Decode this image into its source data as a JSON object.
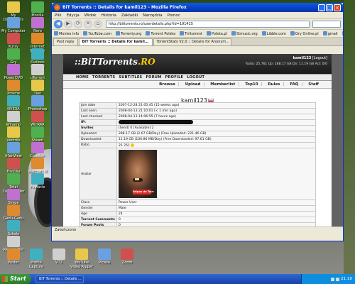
{
  "desktop": {
    "icons_left": [
      "My Documents",
      "My Computer",
      "Kursy",
      "Gry",
      "PowerDVD",
      "Xtreme",
      "NVIDIA Control",
      "Winamp",
      "Ventrilo",
      "IrfanView",
      "FileZilla",
      "Total Commander",
      "Skype",
      "Gadu-Gadu",
      "Szkoła",
      "Recycle Bin"
    ],
    "icons_col2": [
      "Mozilla Firefox",
      "Nero",
      "Internet Explorer",
      "Outlook Express",
      "uTorrent",
      "Tlen",
      "Photoshop",
      "WinRAR",
      "Steam",
      "Counter-Strike",
      "Warcraft III",
      "Pinnacle"
    ],
    "icons_bottom": [
      "Poster",
      "Profile Capture",
      "VT3",
      "YouTube Video Ripper",
      "Picasa",
      "Zoom"
    ]
  },
  "window": {
    "title": "BiT Torrents :: Details for kamil123 - Mozilla Firefox",
    "minimize": "_",
    "maximize": "□",
    "close": "×"
  },
  "menubar": [
    "Plik",
    "Edycja",
    "Widok",
    "Historia",
    "Zakładki",
    "Narzędzia",
    "Pomoc"
  ],
  "navbar": {
    "back": "◀",
    "forward": "▶",
    "reload": "⟳",
    "stop": "✕",
    "home": "⌂",
    "url": "http://bittorrents.ro/userdetails.php?id=191415"
  },
  "bookmarks": [
    "Movies info",
    "YouTube.com",
    "Torrenty.org",
    "Torrent Polska",
    "Tiritorrent",
    "Polska.pl",
    "Stmusic.org",
    "Libble.com",
    "Gry Online.pl",
    "gmail",
    "Wrzuta.pl",
    "Potczak.pl"
  ],
  "tabs": [
    {
      "label": "Post reply",
      "active": false
    },
    {
      "label": "BiT Torrents :: Details for kamil...",
      "active": true
    },
    {
      "label": "TorrentStats V2.0 :: Details for Anonym...",
      "active": false
    }
  ],
  "site": {
    "logo_main": "::BiTTorrents",
    "logo_tail": ".RO",
    "username": "kamil123",
    "logout_label": "[Logout]",
    "ratio_line": "Ratio: 25.761  Up: 288.17 GB  Dn: 11.19 GB  Act: 0/0",
    "main_nav": [
      "HOME",
      "TORRENTS",
      "SUBTITLES",
      "FORUM",
      "PROFILE",
      "LOGOUT"
    ],
    "sub_nav": [
      "Browse",
      "Upload",
      "Memberlist",
      "Top10",
      "Rules",
      "FAQ",
      "Staff"
    ],
    "profile_name": "kamil123"
  },
  "details": {
    "rows": [
      {
        "label": "Join date",
        "value": "2007-12-28 21:05:45 (15 weeks ago)",
        "bold": false
      },
      {
        "label": "Last seen",
        "value": "2008-04-13 21:10:01 (< 1 min ago)",
        "bold": false
      },
      {
        "label": "Last checked",
        "value": "2008-04-13 14:06:55 (7 hours ago)",
        "bold": false
      },
      {
        "label": "IP:",
        "value": "",
        "bold": true,
        "redacted": true
      },
      {
        "label": "Invites",
        "value": "[Send] 0 [Available] 2",
        "bold": true
      },
      {
        "label": "Uploaded",
        "value": "288.17 GB (2.67 GB/Day) (Free Uploaded: 221.46 GB)",
        "bold": false
      },
      {
        "label": "Downloaded",
        "value": "11.19 GB (106.86 MB/Day) (Free Downloaded: 97.61 GB)",
        "bold": false
      },
      {
        "label": "Ratio",
        "value": "25.761",
        "bold": false,
        "smiley": true
      }
    ],
    "avatar_label": "Avatar",
    "avatar_stamp": "Gripon de Taur",
    "rows_after": [
      {
        "label": "Class",
        "value": "Power User",
        "bold": false
      },
      {
        "label": "Gender",
        "value": "Male",
        "bold": false
      },
      {
        "label": "Age",
        "value": "24",
        "bold": false
      },
      {
        "label": "Torrent Comments",
        "value": "0",
        "bold": true
      },
      {
        "label": "Forum Posts",
        "value": "0",
        "bold": true
      }
    ]
  },
  "statusbar": "Zakończono",
  "taskbar": {
    "start": "Start",
    "task": "BiT Torrents :: Details ...",
    "clock": "21:10"
  }
}
